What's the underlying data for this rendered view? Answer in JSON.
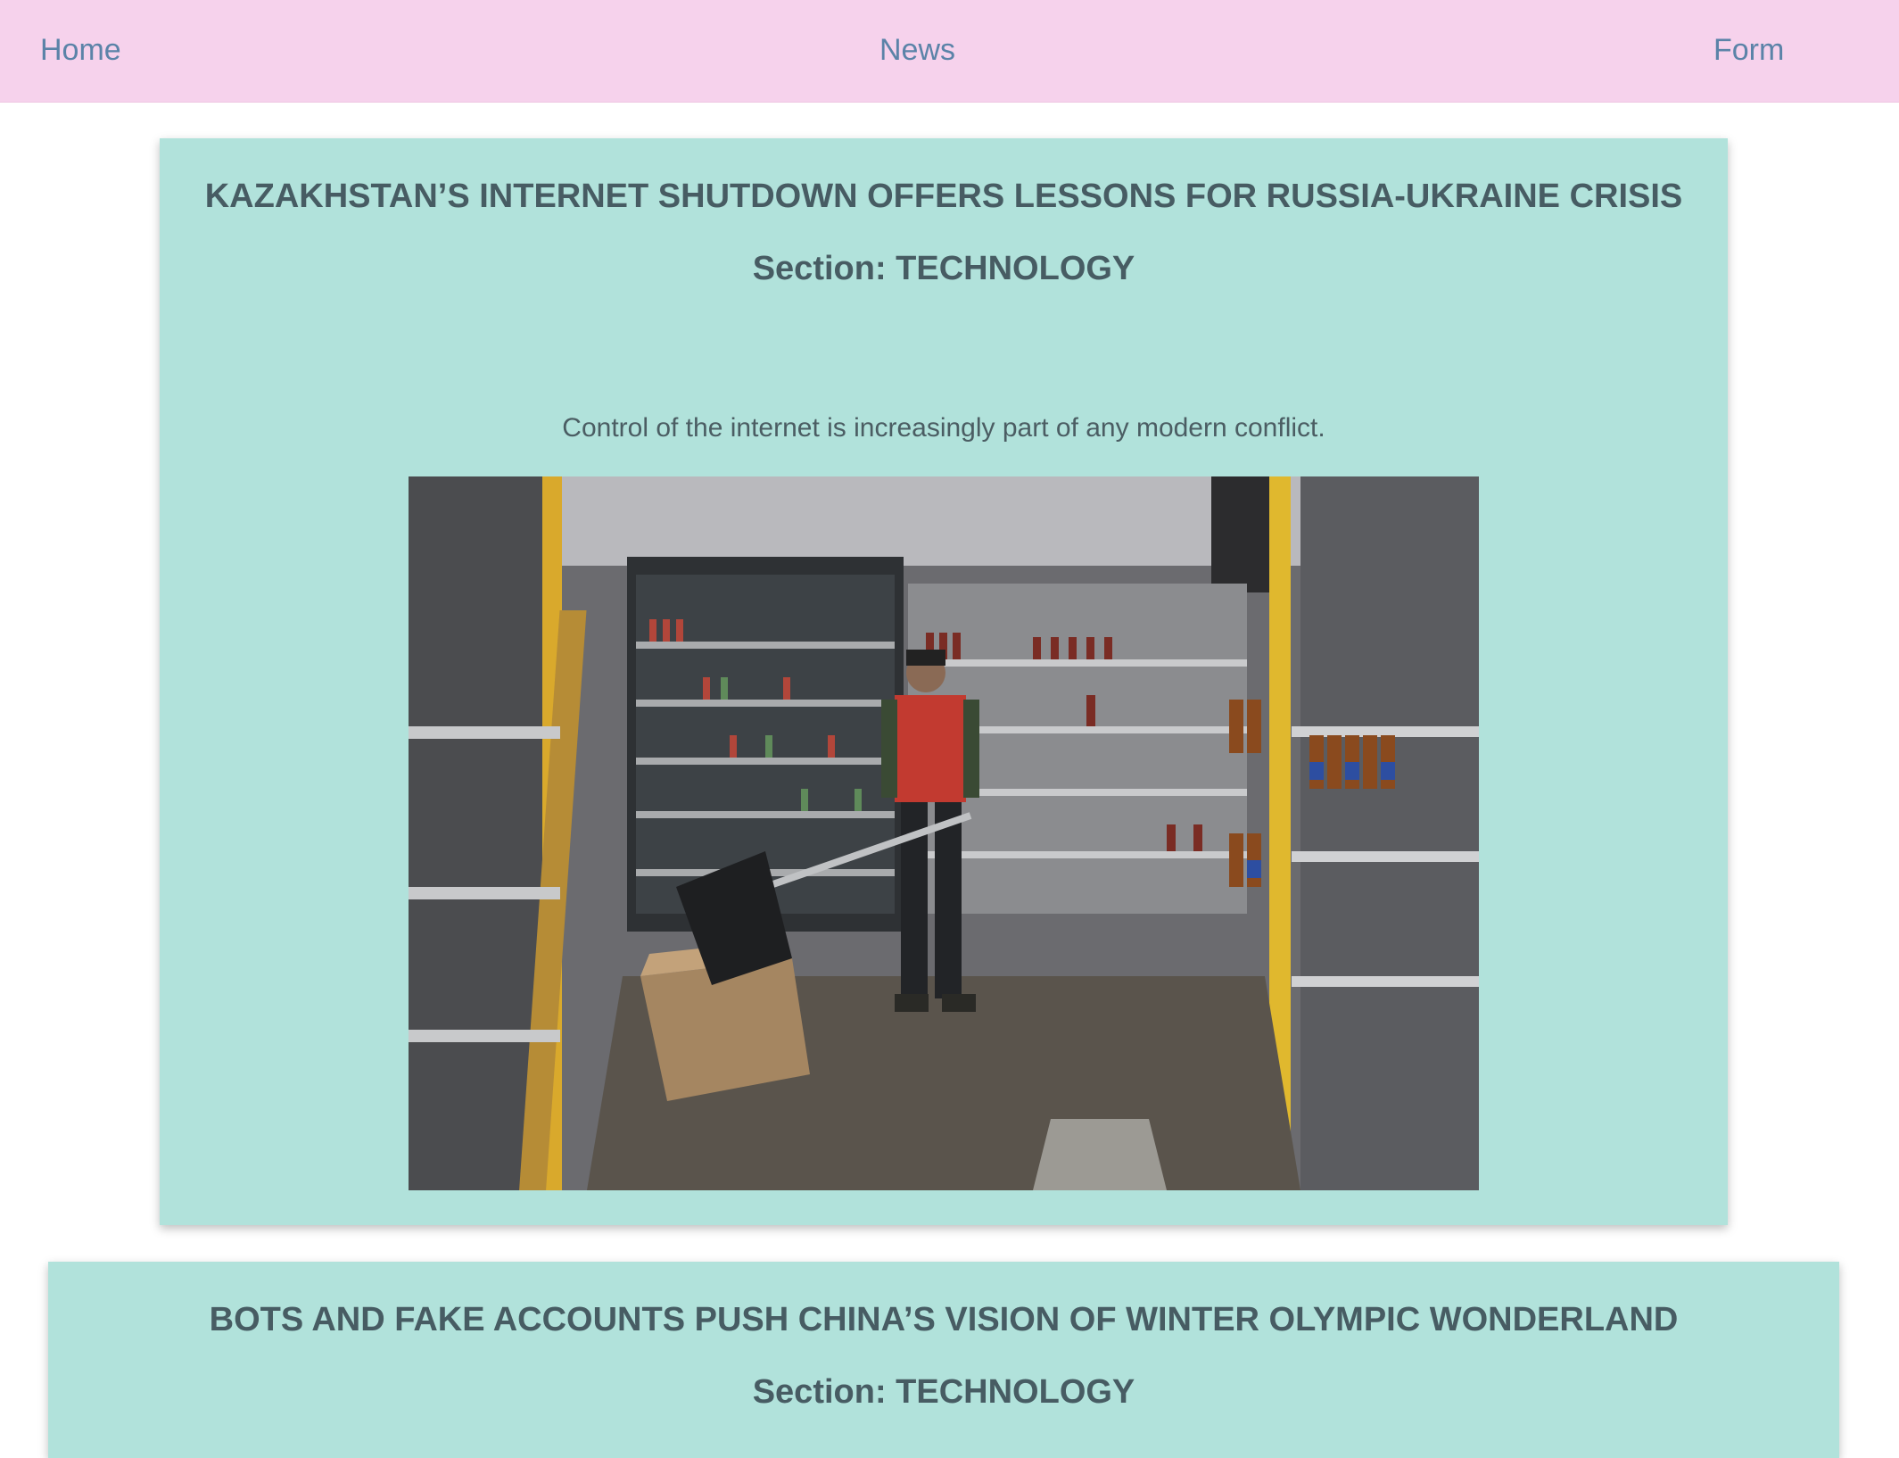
{
  "nav": {
    "home": "Home",
    "news": "News",
    "form": "Form"
  },
  "articles": [
    {
      "title": "KAZAKHSTAN’S INTERNET SHUTDOWN OFFERS LESSONS FOR RUSSIA-UKRAINE CRISIS",
      "section": "Section: TECHNOLOGY",
      "description": "Control of the internet is increasingly part of any modern conflict.",
      "image_alt": "Worker sweeping debris in a looted grocery store aisle"
    },
    {
      "title": "BOTS AND FAKE ACCOUNTS PUSH CHINA’S VISION OF WINTER OLYMPIC WONDERLAND",
      "section": "Section: TECHNOLOGY"
    }
  ],
  "colors": {
    "navbar_bg": "#f6d2ec",
    "nav_link": "#5b83a8",
    "card_bg": "#b1e2db",
    "card_text": "#475c63"
  }
}
